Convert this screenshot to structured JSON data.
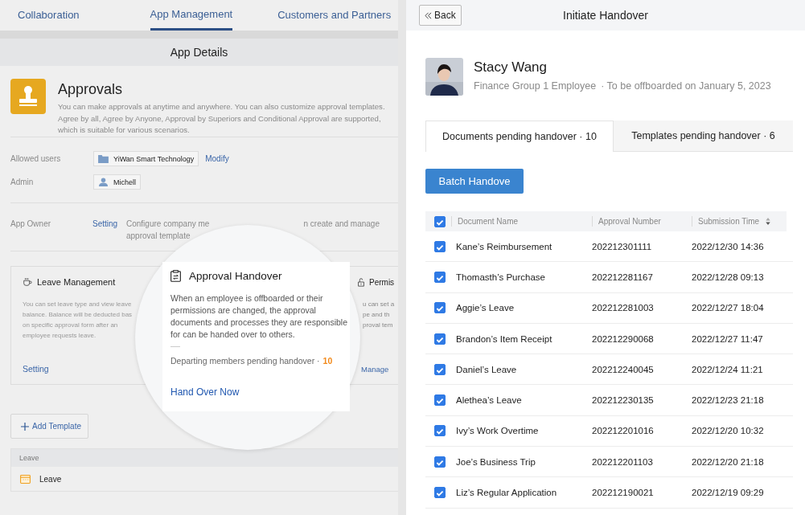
{
  "left": {
    "tabs": [
      {
        "label": "Collaboration",
        "selected": false
      },
      {
        "label": "App Management",
        "selected": true
      },
      {
        "label": "Customers and Partners",
        "selected": false
      }
    ],
    "header": "App Details",
    "app": {
      "name": "Approvals",
      "description": "You can make approvals at anytime and anywhere. You can also customize approval templates. Agree by all, Agree by Anyone, Approval by Superiors and Conditional Approval are supported, which is suitable for various scenarios."
    },
    "fields": [
      {
        "label": "Allowed users",
        "chip": "YiWan Smart Technology",
        "kind": "department",
        "link": "Modify"
      },
      {
        "label": "Admin",
        "chip": "Michell",
        "kind": "person"
      }
    ],
    "owner": {
      "label": "App Owner",
      "link": "Setting",
      "visible_text": [
        "Configure company me",
        "n create and manage",
        "approval template"
      ]
    },
    "cards": [
      {
        "kind": "leave",
        "title": "Leave Management",
        "lines": [
          "You can set leave type and view leave",
          "balance. Balance will be deducted bas",
          "on specific approval form after an",
          "employee requests leave."
        ],
        "link": "Setting"
      },
      {
        "kind": "permission",
        "title": "Permis",
        "lines": [
          "u can set a",
          "pe and th",
          "proval tem"
        ],
        "link": "Manage"
      }
    ],
    "add_button": "Add Template",
    "group": {
      "title": "Leave",
      "items": [
        {
          "name": "Leave"
        }
      ]
    }
  },
  "popup": {
    "title": "Approval Handover",
    "body": "When an employee is offboarded or their permissions are changed, the approval documents and processes they are responsible for can be handed over to others.",
    "pending_label": "Departing members pending handover ·",
    "pending_count": "10",
    "action": "Hand Over Now"
  },
  "right": {
    "back": "Back",
    "title": "Initiate Handover",
    "person": {
      "name": "Stacy Wang",
      "role": "Finance Group 1 Employee",
      "offboard": "· To be offboarded on January 5, 2023"
    },
    "tabs": [
      {
        "label": "Documents pending handover · 10",
        "selected": true
      },
      {
        "label": "Templates pending handover · 6",
        "selected": false
      }
    ],
    "batch_button": "Batch Handove",
    "table": {
      "all_checked": true,
      "columns": [
        "Document Name",
        "Approval Number",
        "Submission Time"
      ],
      "rows": [
        {
          "name": "Kane’s Reimbursement",
          "number": "202212301111",
          "time": "2022/12/30 14:36",
          "checked": true
        },
        {
          "name": "Thomasth’s  Purchase",
          "number": "202212281167",
          "time": "2022/12/28 09:13",
          "checked": true
        },
        {
          "name": "Aggie’s Leave",
          "number": "202212281003",
          "time": "2022/12/27 18:04",
          "checked": true
        },
        {
          "name": "Brandon’s Item Receipt",
          "number": "202212290068",
          "time": "2022/12/27 11:47",
          "checked": true
        },
        {
          "name": "Daniel’s Leave",
          "number": "202212240045",
          "time": "2022/12/24 11:21",
          "checked": true
        },
        {
          "name": "Alethea’s Leave",
          "number": "202212230135",
          "time": "2022/12/23 21:18",
          "checked": true
        },
        {
          "name": "Ivy’s Work Overtime",
          "number": "202212201016",
          "time": "2022/12/20 10:32",
          "checked": true
        },
        {
          "name": "Joe’s Business Trip",
          "number": "202212201103",
          "time": "2022/12/20 21:18",
          "checked": true
        },
        {
          "name": "Liz’s Regular Application",
          "number": "202212190021",
          "time": "2022/12/19 09:29",
          "checked": true
        }
      ]
    }
  }
}
